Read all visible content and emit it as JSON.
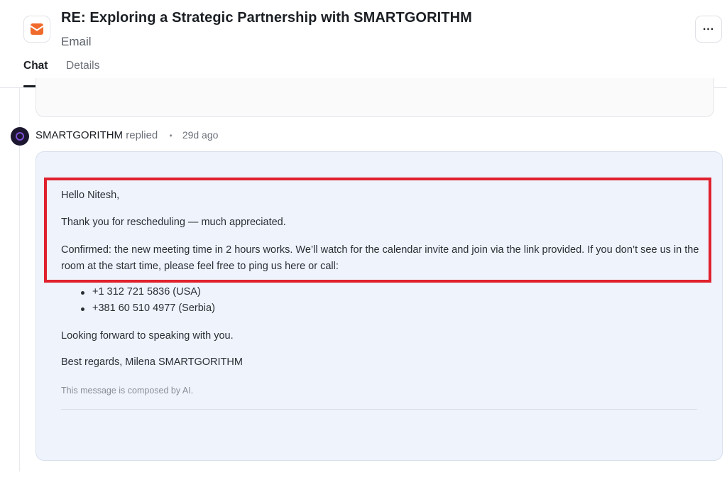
{
  "header": {
    "app_icon": "email-icon",
    "title": "RE: Exploring a Strategic Partnership with SMARTGORITHM",
    "subtitle": "Email",
    "more_icon": "more-horizontal-icon",
    "more_label": "..."
  },
  "tabs": [
    {
      "label": "Chat",
      "active": true
    },
    {
      "label": "Details",
      "active": false
    }
  ],
  "reply": {
    "sender": "SMARTGORITHM",
    "action": "replied",
    "separator": "•",
    "time": "29d ago",
    "avatar_icon": "smartgorithm-avatar"
  },
  "message": {
    "greeting": "Hello Nitesh,",
    "thanks": "Thank you for rescheduling — much appreciated.",
    "confirm": "Confirmed: the new meeting time in 2 hours works. We’ll watch for the calendar invite and join via the link provided. If you don’t see us in the room at the start time, please feel free to ping us here or call:",
    "phones": [
      "+1 312 721 5836 (USA)",
      "+381 60 510 4977 (Serbia)"
    ],
    "closing": "Looking forward to speaking with you.",
    "signature": "Best regards, Milena SMARTGORITHM",
    "ai_note": "This message is composed by AI."
  },
  "colors": {
    "highlight": "#e0212e",
    "card_bg": "#eef3fc",
    "email_icon": "#f06a2b",
    "avatar_bg": "#1d1630",
    "avatar_ring": "#7e4fd6"
  }
}
